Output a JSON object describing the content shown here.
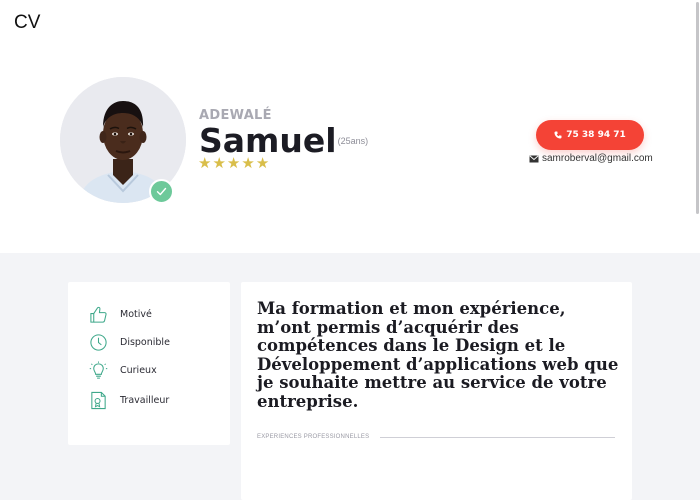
{
  "page": {
    "title": "CV"
  },
  "profile": {
    "first_name": "ADEWALÉ",
    "last_name": "Samuel",
    "age": "(25ans)",
    "rating": 5,
    "rating_max": 5,
    "stars_glyph": "★★★★★",
    "phone": "75 38 94 71",
    "email": "samroberval@gmail.com",
    "verified": true
  },
  "skills": [
    {
      "label": "Motivé",
      "icon": "thumbs-up-icon"
    },
    {
      "label": "Disponible",
      "icon": "clock-icon"
    },
    {
      "label": "Curieux",
      "icon": "lightbulb-icon"
    },
    {
      "label": "Travailleur",
      "icon": "certificate-icon"
    }
  ],
  "main": {
    "intro": "Ma formation et mon expérience, m’ont permis d’acquérir des compétences dans le Design et le Développement d’applications web que je souhaite mettre au service de votre entreprise.",
    "section_title": "EXPERIENCES PROFESSIONNELLES"
  },
  "colors": {
    "accent": "#f44336",
    "verified": "#6dc99a",
    "star": "#d9be4a",
    "icon": "#3ea88a",
    "background": "#f3f4f7"
  }
}
